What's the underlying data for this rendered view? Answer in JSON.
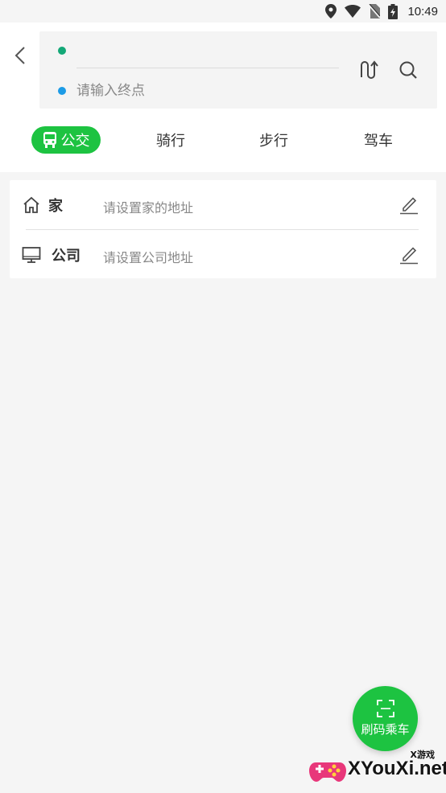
{
  "status_bar": {
    "time": "10:49",
    "icons": [
      "location-icon",
      "wifi-icon",
      "no-sim-icon",
      "battery-icon"
    ]
  },
  "route": {
    "start_value": "",
    "end_placeholder": "请输入终点",
    "start_dot_color": "#13a877",
    "end_dot_color": "#1c9be6"
  },
  "tabs": [
    {
      "label": "公交",
      "active": true,
      "icon": "bus-icon"
    },
    {
      "label": "骑行",
      "active": false
    },
    {
      "label": "步行",
      "active": false
    },
    {
      "label": "驾车",
      "active": false
    }
  ],
  "places": [
    {
      "title": "家",
      "hint": "请设置家的地址",
      "icon": "home-icon"
    },
    {
      "title": "公司",
      "hint": "请设置公司地址",
      "icon": "computer-icon"
    }
  ],
  "fab": {
    "label": "刷码乘车",
    "icon": "scan-icon"
  },
  "watermark": {
    "small": "X游戏",
    "big": "XYouXi.net"
  },
  "colors": {
    "accent": "#1dc341",
    "background": "#f5f5f5"
  }
}
